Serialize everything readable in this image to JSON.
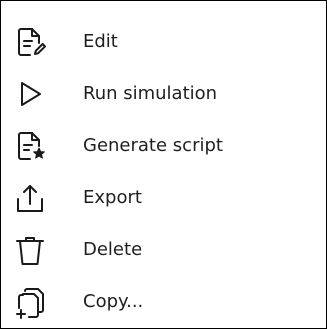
{
  "menu": {
    "items": [
      {
        "label": "Edit",
        "icon": "edit-document-icon"
      },
      {
        "label": "Run simulation",
        "icon": "play-icon"
      },
      {
        "label": "Generate script",
        "icon": "script-settings-icon"
      },
      {
        "label": "Export",
        "icon": "export-icon"
      },
      {
        "label": "Delete",
        "icon": "trash-icon"
      },
      {
        "label": "Copy...",
        "icon": "copy-icon"
      }
    ]
  },
  "colors": {
    "text": "#1f1f1f",
    "icon": "#1a1a1a",
    "border": "#000000",
    "background": "#ffffff"
  }
}
